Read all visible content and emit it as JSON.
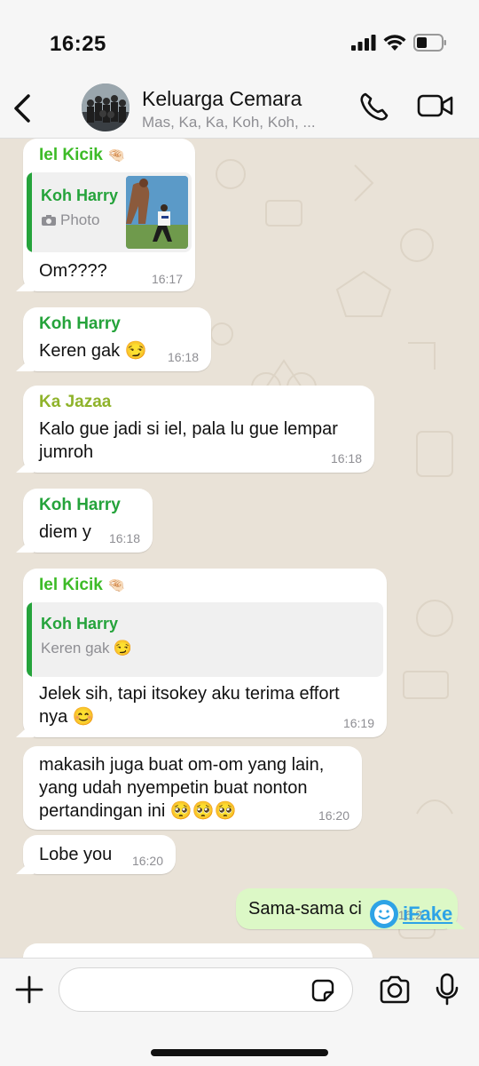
{
  "status_bar": {
    "time": "16:25"
  },
  "header": {
    "title": "Keluarga Cemara",
    "subtitle": "Mas, Ka, Ka, Koh, Koh, ..."
  },
  "messages": [
    {
      "sender": "Iel Kicik",
      "sender_color": "#3dbb27",
      "reply": {
        "sender": "Koh Harry",
        "text": "Photo",
        "icon": "camera-icon"
      },
      "text": "Om????",
      "time": "16:17"
    },
    {
      "sender": "Koh Harry",
      "sender_color": "#25a33b",
      "text": "Keren gak",
      "emoji": "smirk-emoji",
      "time": "16:18"
    },
    {
      "sender": "Ka Jazaa",
      "sender_color": "#8fb32b",
      "text_lines": [
        "Kalo gue jadi si iel, pala lu gue lempar",
        "jumroh"
      ],
      "time": "16:18"
    },
    {
      "sender": "Koh Harry",
      "sender_color": "#25a33b",
      "text": "diem y",
      "time": "16:18"
    },
    {
      "sender": "Iel Kicik",
      "sender_color": "#3dbb27",
      "reply": {
        "sender": "Koh Harry",
        "text": "Keren gak",
        "emoji": "smirk-emoji"
      },
      "text_lines": [
        "Jelek sih, tapi itsokey aku terima effort",
        "nya"
      ],
      "emoji": "smile-emoji",
      "time": "16:19"
    },
    {
      "text_lines": [
        "makasih juga buat om-om yang lain,",
        "yang udah nyempetin buat nonton",
        "pertandingan ini"
      ],
      "emoji": "pleading-emoji-x3",
      "time": "16:20"
    },
    {
      "text": "Lobe you",
      "time": "16:20"
    },
    {
      "outgoing": true,
      "text": "Sama-sama ci",
      "time": "16:2"
    }
  ],
  "composer": {
    "placeholder": ""
  },
  "watermark": {
    "text": "iFake"
  },
  "colors": {
    "chat_background": "#e9e2d7",
    "outgoing_bubble": "#dcf8c6",
    "incoming_bubble": "#ffffff",
    "accent_blue": "#007aff"
  }
}
